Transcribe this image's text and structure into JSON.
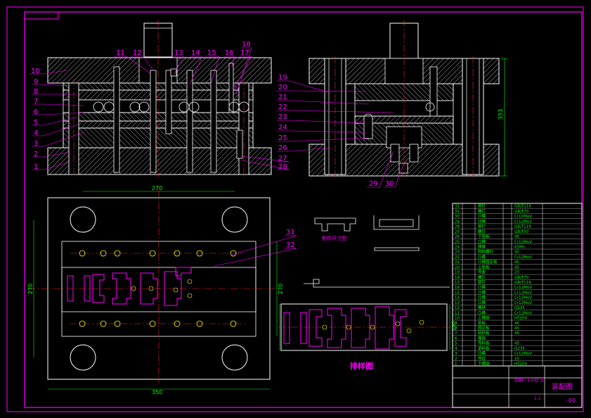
{
  "colors": {
    "background": "#000000",
    "frame": "#ff00ff",
    "part": "#ffffff",
    "centerline": "#ff2020",
    "dimension": "#00ff00",
    "hatch": "#ffffff",
    "leader": "#ff00ff",
    "hole": "#ffff00",
    "table_text": "#00ff00"
  },
  "balloons_left": [
    "1",
    "2",
    "3",
    "4",
    "5",
    "6",
    "7",
    "8",
    "9",
    "10"
  ],
  "balloons_top": [
    "11",
    "12",
    "13",
    "14",
    "15",
    "16",
    "17",
    "18"
  ],
  "balloons_right_view": [
    "19",
    "20",
    "21",
    "22",
    "23",
    "24",
    "25",
    "26",
    "27",
    "28",
    "29",
    "30"
  ],
  "balloons_plan": [
    "31",
    "32"
  ],
  "dimensions": {
    "plan_top_width": "270",
    "plan_bottom_width": "350",
    "plan_left_height": "270",
    "plan_right_height": "270",
    "section_height": "353",
    "strip_height": "100",
    "section_top_width": "100"
  },
  "labels": {
    "strip_layout_title": "排样图",
    "part_label_1": "制件尺寸图",
    "part_label_2": "",
    "tolerance_note": "08F T=0.5",
    "drawing_title": "装配图",
    "scale_note": "1:1",
    "sheet_no": "-00"
  },
  "bom_rows": [
    [
      "32",
      "",
      "销钉",
      "",
      "GB/T119"
    ],
    [
      "31",
      "",
      "螺钉",
      "",
      "GB/T70"
    ],
    [
      "30",
      "",
      "凸模",
      "",
      "Cr12MoV"
    ],
    [
      "29",
      "",
      "凹模",
      "",
      "Cr12MoV"
    ],
    [
      "28",
      "",
      "销钉",
      "",
      "GB/T119"
    ],
    [
      "27",
      "",
      "螺钉",
      "",
      "GB/T70"
    ],
    [
      "26",
      "",
      "下垫板",
      "",
      "45"
    ],
    [
      "25",
      "",
      "凸模",
      "",
      "Cr12MoV"
    ],
    [
      "24",
      "",
      "弹簧",
      "",
      "65Mn"
    ],
    [
      "23",
      "",
      "卸料螺钉",
      "",
      "45"
    ],
    [
      "22",
      "",
      "凸模",
      "",
      "Cr12MoV"
    ],
    [
      "21",
      "",
      "凸模固定板",
      "",
      "45"
    ],
    [
      "20",
      "",
      "上垫板",
      "",
      "45"
    ],
    [
      "19",
      "",
      "导套",
      "",
      "20"
    ],
    [
      "18",
      "",
      "螺钉",
      "",
      "GB/T70"
    ],
    [
      "17",
      "",
      "销钉",
      "",
      "GB/T119"
    ],
    [
      "16",
      "",
      "凸模",
      "",
      "Cr12MoV"
    ],
    [
      "15",
      "",
      "凸模",
      "",
      "Cr12MoV"
    ],
    [
      "14",
      "",
      "凸模",
      "",
      "Cr12MoV"
    ],
    [
      "13",
      "",
      "凸模",
      "",
      "Cr12MoV"
    ],
    [
      "12",
      "",
      "模柄",
      "",
      "Q235"
    ],
    [
      "11",
      "",
      "凸模",
      "",
      "Cr12MoV"
    ],
    [
      "10",
      "",
      "上模座",
      "",
      "HT200"
    ],
    [
      "9",
      "",
      "垫板",
      "",
      "45"
    ],
    [
      "8",
      "",
      "固定板",
      "",
      "45"
    ],
    [
      "7",
      "",
      "卸料板",
      "",
      "45"
    ],
    [
      "6",
      "",
      "橡胶",
      "",
      ""
    ],
    [
      "5",
      "",
      "导料板",
      "",
      "45"
    ],
    [
      "4",
      "",
      "承料板",
      "",
      "Q235"
    ],
    [
      "3",
      "",
      "凹模",
      "",
      "Cr12MoV"
    ],
    [
      "2",
      "",
      "导柱",
      "",
      "20"
    ],
    [
      "1",
      "",
      "下模座",
      "",
      "HT200"
    ]
  ]
}
